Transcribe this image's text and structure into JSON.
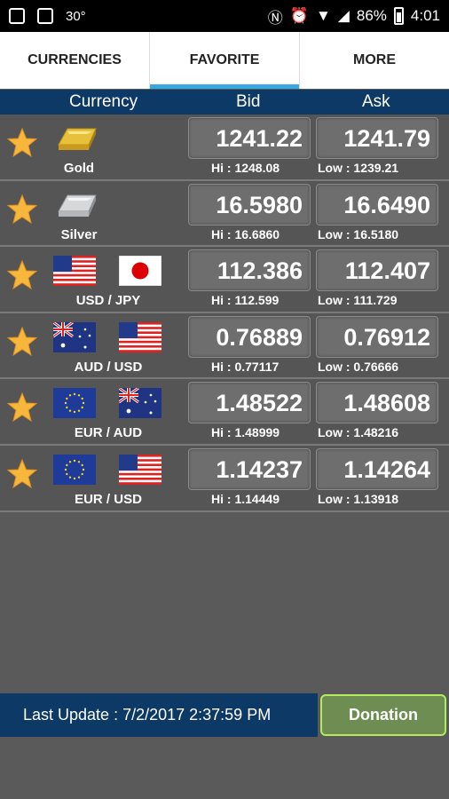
{
  "status_bar": {
    "temperature": "30°",
    "battery": "86%",
    "time": "4:01"
  },
  "tabs": [
    {
      "label": "CURRENCIES",
      "active": false
    },
    {
      "label": "FAVORITE",
      "active": true
    },
    {
      "label": "MORE",
      "active": false
    }
  ],
  "columns": {
    "currency": "Currency",
    "bid": "Bid",
    "ask": "Ask"
  },
  "rows": [
    {
      "name": "Gold",
      "bid": "1241.22",
      "ask": "1241.79",
      "hi": "Hi : 1248.08",
      "low": "Low : 1239.21"
    },
    {
      "name": "Silver",
      "bid": "16.5980",
      "ask": "16.6490",
      "hi": "Hi : 16.6860",
      "low": "Low : 16.5180"
    },
    {
      "base": "USD",
      "sep": "/",
      "quote": "JPY",
      "bid": "112.386",
      "ask": "112.407",
      "hi": "Hi : 112.599",
      "low": "Low : 111.729"
    },
    {
      "base": "AUD",
      "sep": "/",
      "quote": "USD",
      "bid": "0.76889",
      "ask": "0.76912",
      "hi": "Hi : 0.77117",
      "low": "Low : 0.76666"
    },
    {
      "base": "EUR",
      "sep": "/",
      "quote": "AUD",
      "bid": "1.48522",
      "ask": "1.48608",
      "hi": "Hi : 1.48999",
      "low": "Low : 1.48216"
    },
    {
      "base": "EUR",
      "sep": "/",
      "quote": "USD",
      "bid": "1.14237",
      "ask": "1.14264",
      "hi": "Hi : 1.14449",
      "low": "Low : 1.13918"
    }
  ],
  "footer": {
    "last_update": "Last Update : 7/2/2017 2:37:59 PM",
    "donation_label": "Donation"
  },
  "colors": {
    "header_bg": "#0d3966",
    "tab_indicator": "#37a8e0",
    "donation_border": "#b4ea5e"
  }
}
